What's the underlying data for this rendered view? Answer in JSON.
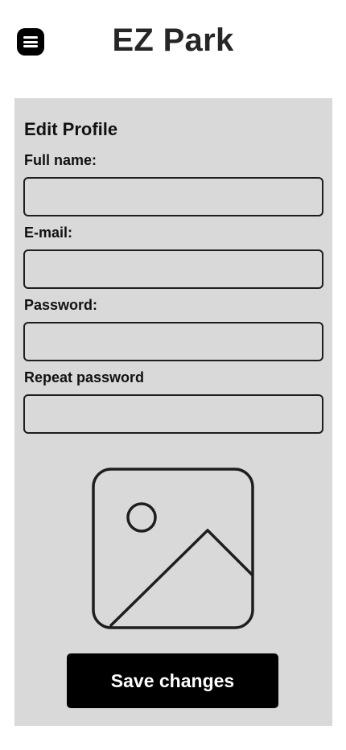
{
  "header": {
    "menu_icon": "hamburger-menu-icon",
    "title": "EZ Park"
  },
  "form": {
    "title": "Edit Profile",
    "fields": [
      {
        "label": "Full name:",
        "value": "",
        "placeholder": ""
      },
      {
        "label": "E-mail:",
        "value": "",
        "placeholder": ""
      },
      {
        "label": "Password:",
        "value": "",
        "placeholder": ""
      },
      {
        "label": "Repeat password",
        "value": "",
        "placeholder": ""
      }
    ],
    "image_icon": "image-placeholder-icon",
    "save_label": "Save changes"
  },
  "colors": {
    "panel_background": "#d9d9d9",
    "button_background": "#000000",
    "button_text": "#ffffff"
  }
}
